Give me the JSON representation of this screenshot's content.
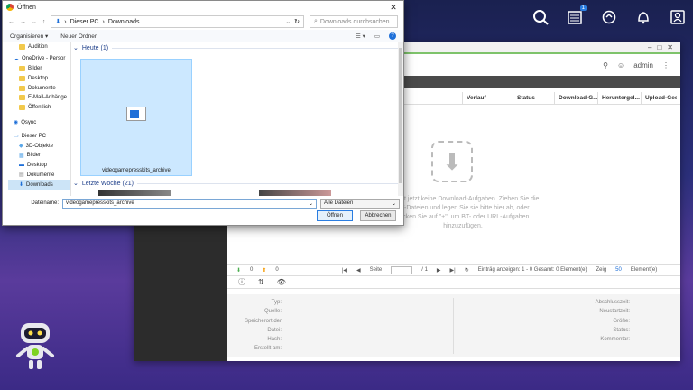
{
  "dialog": {
    "title": "Öffnen",
    "breadcrumb": [
      "Dieser PC",
      "Downloads"
    ],
    "search_placeholder": "Downloads durchsuchen",
    "toolbar": {
      "organize": "Organisieren",
      "new_folder": "Neuer Ordner"
    },
    "nav_items": [
      {
        "label": "Audition",
        "icon": "folder-icon",
        "selected": false
      },
      {
        "label": "OneDrive - Persor",
        "icon": "cloud-icon",
        "selected": false
      },
      {
        "label": "Bilder",
        "icon": "folder-icon",
        "selected": false
      },
      {
        "label": "Desktop",
        "icon": "folder-icon",
        "selected": false
      },
      {
        "label": "Dokumente",
        "icon": "folder-icon",
        "selected": false
      },
      {
        "label": "E-Mail-Anhänge",
        "icon": "folder-icon",
        "selected": false
      },
      {
        "label": "Öffentlich",
        "icon": "folder-icon",
        "selected": false
      },
      {
        "label": "Qsync",
        "icon": "qsync-icon",
        "selected": false
      },
      {
        "label": "Dieser PC",
        "icon": "pc-icon",
        "selected": false
      },
      {
        "label": "3D-Objekte",
        "icon": "cube-icon",
        "selected": false
      },
      {
        "label": "Bilder",
        "icon": "pictures-icon",
        "selected": false
      },
      {
        "label": "Desktop",
        "icon": "desktop-icon",
        "selected": false
      },
      {
        "label": "Dokumente",
        "icon": "documents-icon",
        "selected": false
      },
      {
        "label": "Downloads",
        "icon": "download-icon",
        "selected": true
      }
    ],
    "groups": {
      "today": "Heute (1)",
      "last_week": "Letzte Woche (21)"
    },
    "file": {
      "name": "videogamepresskits_archive"
    },
    "filename_label": "Dateiname:",
    "filename_value": "videogamepresskits_archive",
    "filetype": "Alle Dateien",
    "open_btn": "Öffnen",
    "cancel_btn": "Abbrechen"
  },
  "app": {
    "user": "admin",
    "columns": [
      "Verlauf",
      "Status",
      "Download-G...",
      "Heruntergel...",
      "Upload-Gesc"
    ],
    "empty_text": "Es gibt jetzt keine Download-Aufgaben. Ziehen Sie die BT-Dateien und legen Sie sie bitte hier ab, oder klicken Sie auf \"+\", um BT- oder URL-Aufgaben hinzuzufügen.",
    "footer": {
      "down_count": "0",
      "up_count": "0",
      "page_label": "Seite",
      "page_total": "/ 1",
      "entries": "Einträg anzeigen: 1 - 0 Gesamt: 0 Element(e)",
      "show_label": "Zeig",
      "show_value": "50",
      "elements": "Element(e)"
    },
    "details_left": [
      "Typ:",
      "Quelle:",
      "Speicherort der",
      "Datei:",
      "Hash:",
      "Erstellt am:"
    ],
    "details_right": [
      "Abschlusszeit:",
      "Neustartzeit:",
      "Größe:",
      "Status:",
      "Kommentar:"
    ]
  },
  "colors": {
    "accent": "#1e6fd8",
    "selection": "#cce8ff",
    "app_green": "#7ec36b"
  }
}
